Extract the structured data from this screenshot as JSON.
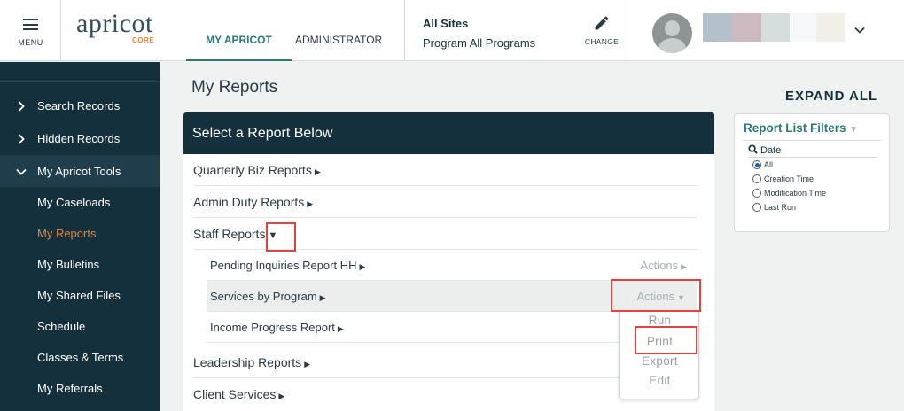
{
  "header": {
    "menu_label": "MENU",
    "logo_word": "apricot",
    "logo_sub": "CORE",
    "tabs": [
      {
        "label": "MY APRICOT",
        "active": true
      },
      {
        "label": "ADMINISTRATOR",
        "active": false
      }
    ],
    "site": {
      "title": "All Sites",
      "program": "Program All Programs"
    },
    "change_label": "CHANGE",
    "user_blur_colors": [
      "#b4c0cb",
      "#cdbac0",
      "#d6dedd",
      "#f7f8f9",
      "#f3f0e9"
    ]
  },
  "sidebar": {
    "items": [
      {
        "label": "Search Records",
        "icon": "chevron-right-icon"
      },
      {
        "label": "Hidden Records",
        "icon": "chevron-right-icon"
      },
      {
        "label": "My Apricot Tools",
        "icon": "chevron-down-icon"
      }
    ],
    "sub_items": [
      {
        "label": "My Caseloads",
        "active": false
      },
      {
        "label": "My Reports",
        "active": true
      },
      {
        "label": "My Bulletins",
        "active": false
      },
      {
        "label": "My Shared Files",
        "active": false
      },
      {
        "label": "Schedule",
        "active": false
      },
      {
        "label": "Classes & Terms",
        "active": false
      },
      {
        "label": "My Referrals",
        "active": false
      }
    ]
  },
  "main": {
    "page_title": "My Reports",
    "expand_all": "EXPAND ALL",
    "panel_title": "Select a Report Below",
    "groups": [
      {
        "label": "Quarterly Biz Reports"
      },
      {
        "label": "Admin Duty Reports"
      },
      {
        "label": "Staff Reports"
      },
      {
        "label": "Leadership Reports"
      },
      {
        "label": "Client Services"
      }
    ],
    "staff_reports": [
      {
        "label": "Pending Inquiries Report HH",
        "actions": "Actions"
      },
      {
        "label": "Services by Program",
        "actions": "Actions"
      },
      {
        "label": "Income Progress Report"
      }
    ],
    "actions_menu": [
      "Run",
      "Print",
      "Export",
      "Edit"
    ]
  },
  "filters": {
    "title": "Report List Filters",
    "date_label": "Date",
    "options": [
      {
        "label": "All",
        "selected": true
      },
      {
        "label": "Creation Time",
        "selected": false
      },
      {
        "label": "Modification Time",
        "selected": false
      },
      {
        "label": "Last Run",
        "selected": false
      }
    ]
  },
  "colors": {
    "navy": "#15303d",
    "teal": "#2c7a78",
    "orange": "#e0843a",
    "highlight_red": "#e0443f"
  }
}
